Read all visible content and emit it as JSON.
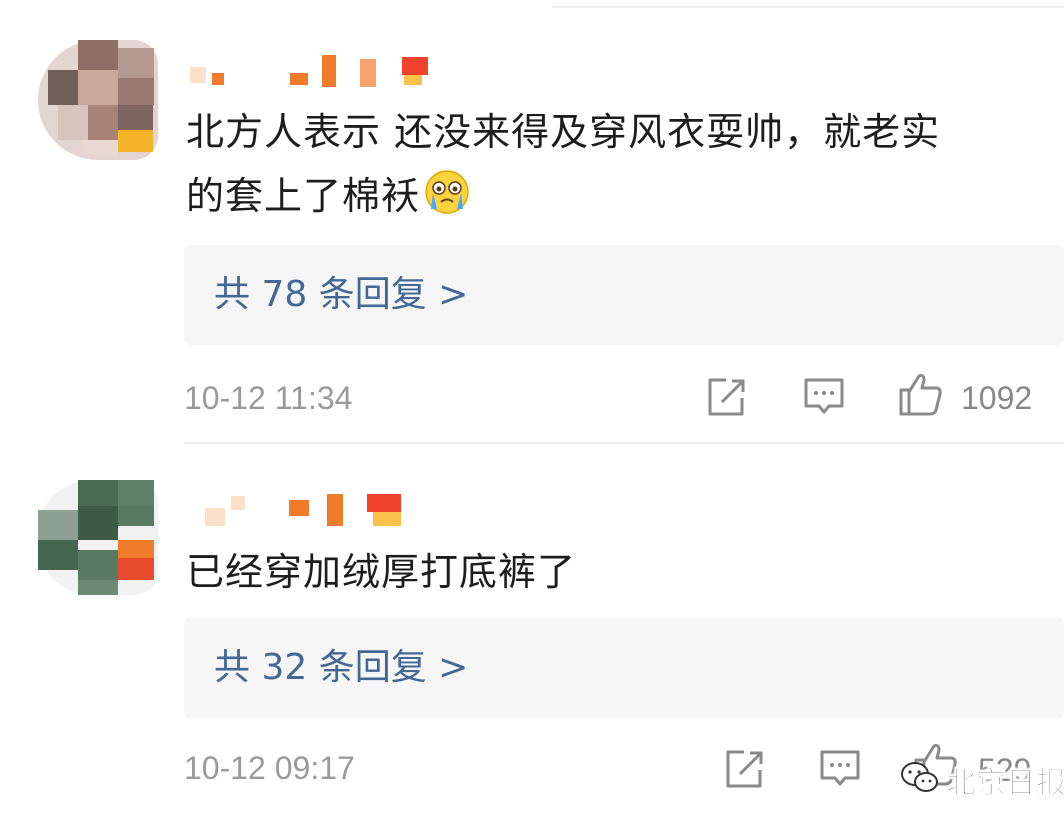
{
  "comments": [
    {
      "text_line1": "北方人表示 还没来得及穿风衣耍帅，就老实",
      "text_line2": "的套上了棉袄",
      "emoji": "crying-face-emoji",
      "replies_label": "共 78 条回复 >",
      "timestamp": "10-12 11:34",
      "likes": "1092"
    },
    {
      "text_line1": "已经穿加绒厚打底裤了",
      "replies_label": "共 32 条回复 >",
      "timestamp": "10-12 09:17",
      "likes": "529"
    }
  ],
  "icons": {
    "share": "share-icon",
    "comment": "comment-icon",
    "like": "thumbs-up-icon"
  },
  "colors": {
    "reply_link": "#436895",
    "reply_box_bg": "#f6f6f6",
    "meta_text": "#9a9a9a",
    "username_orange": "#f07b2a",
    "username_red": "#f0422a"
  },
  "watermark": {
    "text": "北京日报"
  }
}
